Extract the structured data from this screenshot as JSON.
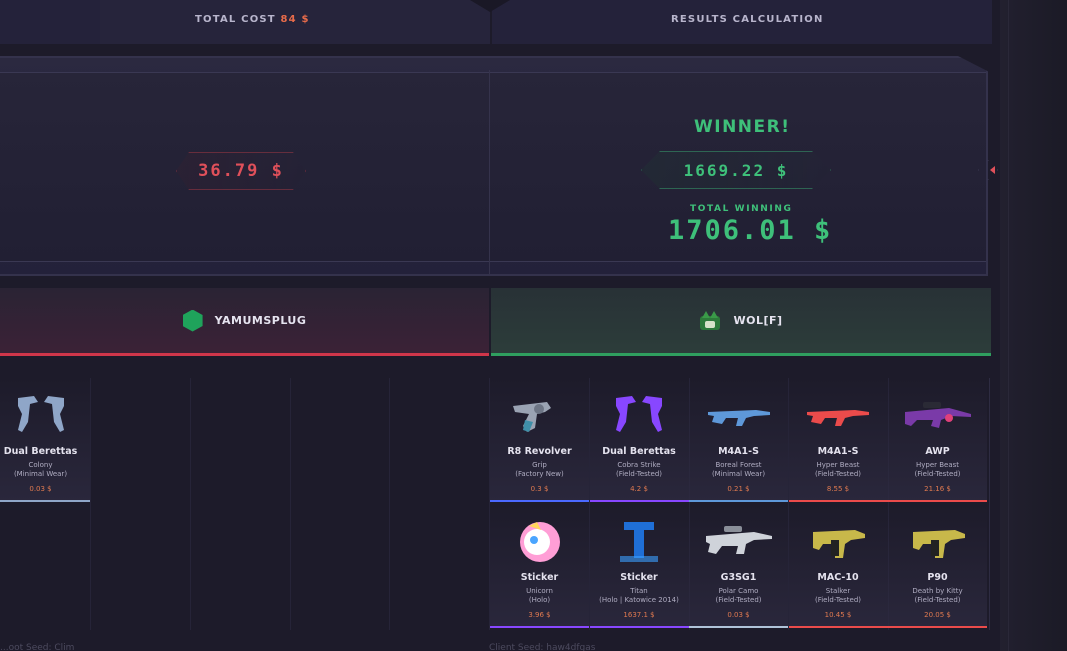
{
  "header": {
    "total_cost_label": "TOTAL COST",
    "total_cost_value": "84 $",
    "results_label": "RESULTS CALCULATION"
  },
  "result": {
    "loser_amount": "36.79 $",
    "winner_label": "WINNER!",
    "winner_amount": "1669.22 $",
    "total_winning_label": "TOTAL WINNING",
    "total_winning_value": "1706.01 $"
  },
  "players": {
    "left": {
      "name": "YAMUMSPLUG",
      "accent": "#d0364a"
    },
    "right": {
      "name": "WOL[F]",
      "accent": "#2f9f5f"
    }
  },
  "left_items": [
    {
      "name": "Dual Berettas",
      "skin": "Colony",
      "wear": "(Minimal Wear)",
      "price": "0.03 $",
      "rarity_color": "#8fa6c8",
      "icon": "dual-berettas-icon"
    }
  ],
  "right_items": [
    {
      "name": "R8 Revolver",
      "skin": "Grip",
      "wear": "(Factory New)",
      "price": "0.3 $",
      "rarity_color": "#4b69ff",
      "icon": "revolver-icon"
    },
    {
      "name": "Dual Berettas",
      "skin": "Cobra Strike",
      "wear": "(Field-Tested)",
      "price": "4.2 $",
      "rarity_color": "#8847ff",
      "icon": "dual-berettas-icon"
    },
    {
      "name": "M4A1-S",
      "skin": "Boreal Forest",
      "wear": "(Minimal Wear)",
      "price": "0.21 $",
      "rarity_color": "#5e98d9",
      "icon": "rifle-icon"
    },
    {
      "name": "M4A1-S",
      "skin": "Hyper Beast",
      "wear": "(Field-Tested)",
      "price": "8.55 $",
      "rarity_color": "#eb4b4b",
      "icon": "rifle-icon"
    },
    {
      "name": "AWP",
      "skin": "Hyper Beast",
      "wear": "(Field-Tested)",
      "price": "21.16 $",
      "rarity_color": "#eb4b4b",
      "icon": "sniper-icon"
    },
    {
      "name": "Sticker",
      "skin": "Unicorn",
      "wear": "(Holo)",
      "price": "3.96 $",
      "rarity_color": "#8847ff",
      "icon": "unicorn-sticker-icon"
    },
    {
      "name": "Sticker",
      "skin": "Titan",
      "wear": "(Holo | Katowice 2014)",
      "price": "1637.1 $",
      "rarity_color": "#8847ff",
      "icon": "titan-sticker-icon"
    },
    {
      "name": "G3SG1",
      "skin": "Polar Camo",
      "wear": "(Field-Tested)",
      "price": "0.03 $",
      "rarity_color": "#b0c3d9",
      "icon": "autosniper-icon"
    },
    {
      "name": "MAC-10",
      "skin": "Stalker",
      "wear": "(Field-Tested)",
      "price": "10.45 $",
      "rarity_color": "#eb4b4b",
      "icon": "smg-icon"
    },
    {
      "name": "P90",
      "skin": "Death by Kitty",
      "wear": "(Field-Tested)",
      "price": "20.05 $",
      "rarity_color": "#eb4b4b",
      "icon": "smg-icon"
    }
  ],
  "footer": {
    "left": "...oot Seed: Clim",
    "right": "Client Seed: haw4dfgas"
  }
}
